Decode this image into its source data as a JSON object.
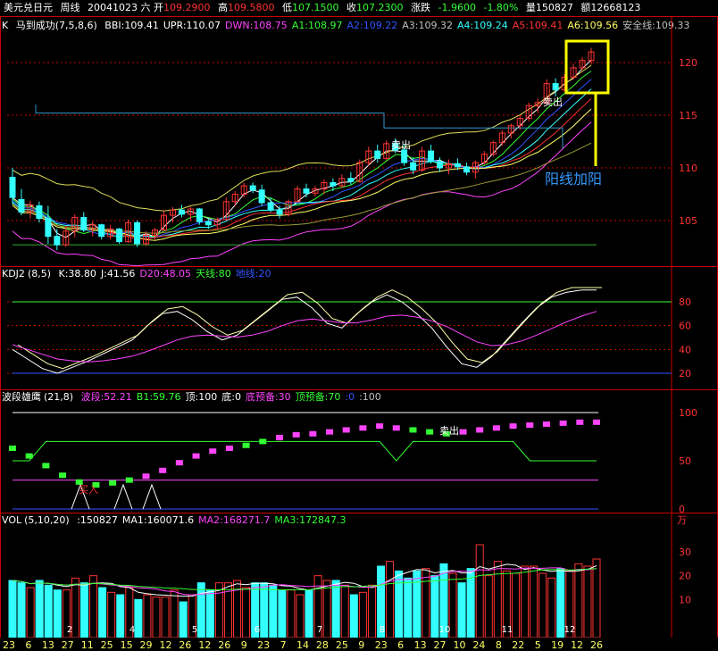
{
  "header": {
    "symbol": "美元兑日元",
    "period": "周线",
    "date": "20041023 六",
    "open_label": "开",
    "open": "109.2900",
    "high_label": "高",
    "high": "109.5800",
    "low_label": "低",
    "low": "107.1500",
    "close_label": "收",
    "close": "107.2300",
    "chg_label": "涨跌",
    "chg": "-1.9600",
    "chg_pct": "-1.80%",
    "vol_label": "量",
    "vol": "150827",
    "amt_label": "额",
    "amt": "12668123"
  },
  "k_panel": {
    "label": "K",
    "name": "马到成功",
    "params": "(7,5,8,6)",
    "items": [
      {
        "text": "BBI:109.41",
        "color": "#ffffff"
      },
      {
        "text": "UPR:110.07",
        "color": "#ffffff"
      },
      {
        "text": "DWN:108.75",
        "color": "#ff44ff"
      },
      {
        "text": "A1:108.97",
        "color": "#33ff33"
      },
      {
        "text": "A2:109.22",
        "color": "#3355ff"
      },
      {
        "text": "A3:109.32",
        "color": "#c0c0c0"
      },
      {
        "text": "A4:109.24",
        "color": "#33ffff"
      },
      {
        "text": "A5:109.41",
        "color": "#ff3333"
      },
      {
        "text": "A6:109.56",
        "color": "#ffff66"
      },
      {
        "text": "安全线:109.33",
        "color": "#c0c0c0"
      }
    ],
    "y_ticks": [
      "120",
      "115",
      "110",
      "105"
    ],
    "annotation": "阳线加阳",
    "sell_label_1": "卖出",
    "sell_label_2": "卖出"
  },
  "kdj_panel": {
    "name": "KDJ2",
    "params": "(8,5)",
    "items": [
      {
        "text": "K:38.80",
        "color": "#ffffff"
      },
      {
        "text": "J:41.56",
        "color": "#ffffff"
      },
      {
        "text": "D20:48.05",
        "color": "#ff44ff"
      },
      {
        "text": "天线:80",
        "color": "#33ff33"
      },
      {
        "text": "地线:20",
        "color": "#3355ff"
      }
    ],
    "y_ticks": [
      "80",
      "60",
      "40",
      "20"
    ]
  },
  "wave_panel": {
    "name": "波段雄鹰",
    "params": "(21,8)",
    "items": [
      {
        "text": "波段:52.21",
        "color": "#ff44ff"
      },
      {
        "text": "B1:59.76",
        "color": "#33ff33"
      },
      {
        "text": "顶:100",
        "color": "#ffffff"
      },
      {
        "text": "底:0",
        "color": "#ffffff"
      },
      {
        "text": "底预备:30",
        "color": "#ff44ff"
      },
      {
        "text": "顶预备:70",
        "color": "#33ff33"
      },
      {
        "text": ":0",
        "color": "#3355ff"
      },
      {
        "text": ":100",
        "color": "#c0c0c0"
      }
    ],
    "y_ticks": [
      "100",
      "50",
      "0"
    ],
    "buy_label": "买入",
    "sell_label": "卖出"
  },
  "vol_panel": {
    "name": "VOL",
    "params": "(5,10,20)",
    "items": [
      {
        "text": ":150827",
        "color": "#ffffff"
      },
      {
        "text": "MA1:160071.6",
        "color": "#ffffff"
      },
      {
        "text": "MA2:168271.7",
        "color": "#ff44ff"
      },
      {
        "text": "MA3:172847.3",
        "color": "#33ff33"
      }
    ],
    "unit": "万",
    "y_ticks": [
      "30",
      "20",
      "10"
    ]
  },
  "x_axis": {
    "labels": [
      "23",
      "6",
      "13",
      "27",
      "11",
      "25",
      "15",
      "29",
      "12",
      "26",
      "12",
      "26",
      "9",
      "23",
      "7",
      "14",
      "28",
      "25",
      "9",
      "23",
      "6",
      "13",
      "27",
      "10",
      "24",
      "8",
      "22",
      "5",
      "19",
      "12",
      "26"
    ],
    "month_markers": [
      "2",
      "4",
      "5",
      "6",
      "7",
      "8",
      "10",
      "11",
      "12"
    ]
  },
  "colors": {
    "up": "#ff3333",
    "down": "#33ffff",
    "text": "#c0c0c0",
    "grid": "#cc0000",
    "highlight": "#ffff00"
  },
  "chart_data": {
    "type": "candlestick",
    "title": "美元兑日元 周线",
    "y_range": [
      101,
      123
    ],
    "candles": [
      {
        "o": 109.1,
        "h": 110.0,
        "l": 106.5,
        "c": 107.2
      },
      {
        "o": 107.0,
        "h": 108.0,
        "l": 105.5,
        "c": 105.8
      },
      {
        "o": 105.8,
        "h": 106.9,
        "l": 105.2,
        "c": 106.5
      },
      {
        "o": 106.4,
        "h": 106.8,
        "l": 104.8,
        "c": 105.2
      },
      {
        "o": 105.2,
        "h": 106.4,
        "l": 102.8,
        "c": 103.5
      },
      {
        "o": 103.5,
        "h": 104.2,
        "l": 102.2,
        "c": 102.7
      },
      {
        "o": 102.7,
        "h": 104.5,
        "l": 102.5,
        "c": 104.0
      },
      {
        "o": 104.0,
        "h": 105.6,
        "l": 103.4,
        "c": 105.3
      },
      {
        "o": 105.3,
        "h": 105.8,
        "l": 103.9,
        "c": 104.1
      },
      {
        "o": 104.1,
        "h": 104.9,
        "l": 103.5,
        "c": 104.6
      },
      {
        "o": 104.6,
        "h": 104.7,
        "l": 103.2,
        "c": 103.5
      },
      {
        "o": 103.5,
        "h": 104.6,
        "l": 103.2,
        "c": 104.2
      },
      {
        "o": 104.2,
        "h": 104.3,
        "l": 102.8,
        "c": 103.0
      },
      {
        "o": 103.0,
        "h": 105.1,
        "l": 102.9,
        "c": 104.8
      },
      {
        "o": 104.8,
        "h": 105.0,
        "l": 102.5,
        "c": 102.8
      },
      {
        "o": 102.8,
        "h": 104.0,
        "l": 102.6,
        "c": 103.6
      },
      {
        "o": 103.6,
        "h": 104.3,
        "l": 103.2,
        "c": 104.1
      },
      {
        "o": 104.1,
        "h": 106.0,
        "l": 104.0,
        "c": 105.5
      },
      {
        "o": 105.5,
        "h": 106.3,
        "l": 104.8,
        "c": 106.0
      },
      {
        "o": 106.0,
        "h": 106.5,
        "l": 105.3,
        "c": 105.6
      },
      {
        "o": 105.6,
        "h": 106.3,
        "l": 105.0,
        "c": 106.1
      },
      {
        "o": 106.1,
        "h": 106.2,
        "l": 104.6,
        "c": 104.9
      },
      {
        "o": 104.9,
        "h": 105.2,
        "l": 104.2,
        "c": 104.6
      },
      {
        "o": 104.6,
        "h": 105.3,
        "l": 104.3,
        "c": 105.1
      },
      {
        "o": 105.1,
        "h": 107.2,
        "l": 105.0,
        "c": 106.8
      },
      {
        "o": 106.8,
        "h": 107.8,
        "l": 106.4,
        "c": 107.5
      },
      {
        "o": 107.5,
        "h": 108.6,
        "l": 107.2,
        "c": 108.3
      },
      {
        "o": 108.3,
        "h": 108.6,
        "l": 107.6,
        "c": 107.9
      },
      {
        "o": 107.9,
        "h": 108.4,
        "l": 106.4,
        "c": 106.7
      },
      {
        "o": 106.7,
        "h": 107.2,
        "l": 105.8,
        "c": 106.0
      },
      {
        "o": 106.0,
        "h": 106.4,
        "l": 105.2,
        "c": 105.6
      },
      {
        "o": 105.6,
        "h": 107.0,
        "l": 105.4,
        "c": 106.8
      },
      {
        "o": 106.8,
        "h": 108.3,
        "l": 106.7,
        "c": 108.0
      },
      {
        "o": 108.0,
        "h": 108.5,
        "l": 107.2,
        "c": 107.6
      },
      {
        "o": 107.6,
        "h": 108.3,
        "l": 107.3,
        "c": 108.0
      },
      {
        "o": 108.0,
        "h": 108.9,
        "l": 107.5,
        "c": 108.6
      },
      {
        "o": 108.6,
        "h": 109.0,
        "l": 107.8,
        "c": 108.3
      },
      {
        "o": 108.3,
        "h": 109.4,
        "l": 108.1,
        "c": 109.0
      },
      {
        "o": 109.0,
        "h": 109.6,
        "l": 108.4,
        "c": 108.7
      },
      {
        "o": 108.7,
        "h": 110.8,
        "l": 108.6,
        "c": 110.5
      },
      {
        "o": 110.5,
        "h": 112.0,
        "l": 110.2,
        "c": 111.6
      },
      {
        "o": 111.6,
        "h": 112.2,
        "l": 110.5,
        "c": 110.9
      },
      {
        "o": 110.9,
        "h": 112.6,
        "l": 110.7,
        "c": 112.3
      },
      {
        "o": 112.3,
        "h": 112.8,
        "l": 111.4,
        "c": 111.7
      },
      {
        "o": 111.7,
        "h": 112.3,
        "l": 110.2,
        "c": 110.5
      },
      {
        "o": 110.5,
        "h": 111.0,
        "l": 109.4,
        "c": 109.8
      },
      {
        "o": 109.8,
        "h": 112.0,
        "l": 109.6,
        "c": 111.6
      },
      {
        "o": 111.6,
        "h": 112.2,
        "l": 110.4,
        "c": 110.6
      },
      {
        "o": 110.6,
        "h": 111.0,
        "l": 109.6,
        "c": 110.0
      },
      {
        "o": 110.0,
        "h": 110.8,
        "l": 109.4,
        "c": 110.4
      },
      {
        "o": 110.4,
        "h": 110.9,
        "l": 109.8,
        "c": 110.1
      },
      {
        "o": 110.1,
        "h": 110.5,
        "l": 109.3,
        "c": 109.6
      },
      {
        "o": 109.6,
        "h": 110.7,
        "l": 109.0,
        "c": 110.5
      },
      {
        "o": 110.5,
        "h": 111.6,
        "l": 110.3,
        "c": 111.3
      },
      {
        "o": 111.3,
        "h": 112.6,
        "l": 111.1,
        "c": 112.4
      },
      {
        "o": 112.4,
        "h": 113.6,
        "l": 112.1,
        "c": 113.3
      },
      {
        "o": 113.3,
        "h": 114.2,
        "l": 112.8,
        "c": 114.0
      },
      {
        "o": 114.0,
        "h": 115.0,
        "l": 113.6,
        "c": 114.7
      },
      {
        "o": 114.7,
        "h": 116.2,
        "l": 114.4,
        "c": 115.9
      },
      {
        "o": 115.9,
        "h": 116.6,
        "l": 115.2,
        "c": 116.2
      },
      {
        "o": 116.2,
        "h": 118.4,
        "l": 116.0,
        "c": 118.0
      },
      {
        "o": 118.0,
        "h": 118.5,
        "l": 116.8,
        "c": 117.4
      },
      {
        "o": 117.4,
        "h": 118.9,
        "l": 117.2,
        "c": 118.6
      },
      {
        "o": 118.6,
        "h": 119.9,
        "l": 118.4,
        "c": 119.5
      },
      {
        "o": 119.5,
        "h": 120.5,
        "l": 119.3,
        "c": 120.2
      },
      {
        "o": 120.2,
        "h": 121.4,
        "l": 119.8,
        "c": 121.0
      }
    ],
    "volume": [
      18,
      17,
      15,
      18,
      16,
      14,
      14,
      19,
      17,
      20,
      15,
      13,
      12,
      15,
      10,
      12,
      11,
      11,
      14,
      9,
      12,
      17,
      14,
      17,
      17,
      18,
      15,
      17,
      17,
      16,
      14,
      14,
      12,
      14,
      20,
      18,
      18,
      16,
      12,
      13,
      16,
      24,
      26,
      22,
      19,
      22,
      23,
      20,
      25,
      21,
      17,
      23,
      33,
      20,
      26,
      22,
      21,
      24,
      24,
      21,
      19,
      23,
      22,
      25,
      24,
      27
    ],
    "kdj_k": [
      40,
      32,
      24,
      20,
      25,
      30,
      36,
      42,
      48,
      60,
      70,
      72,
      65,
      55,
      48,
      52,
      62,
      72,
      82,
      84,
      75,
      62,
      58,
      70,
      80,
      86,
      80,
      70,
      58,
      42,
      28,
      25,
      34,
      48,
      62,
      75,
      84,
      88,
      90,
      90
    ],
    "kdj_d": [
      45,
      40,
      35,
      30,
      28,
      27,
      28,
      30,
      33,
      38,
      44,
      50,
      54,
      55,
      54,
      53,
      55,
      59,
      65,
      70,
      72,
      70,
      68,
      68,
      71,
      75,
      76,
      74,
      70,
      64,
      56,
      48,
      44,
      45,
      49,
      55,
      62,
      69,
      75,
      80
    ],
    "wave": [
      63,
      55,
      45,
      35,
      28,
      25,
      27,
      30,
      34,
      40,
      48,
      55,
      60,
      63,
      66,
      70,
      74,
      77,
      78,
      80,
      82,
      84,
      86,
      84,
      82,
      80,
      78,
      80,
      82,
      84,
      86,
      87,
      88,
      89,
      90,
      90
    ],
    "wave_b1": [
      50,
      50,
      70,
      70,
      70,
      70,
      70,
      70,
      70,
      70,
      70,
      70,
      70,
      70,
      70,
      70,
      70,
      70,
      70,
      70,
      70,
      70,
      70,
      50,
      70,
      70,
      70,
      70,
      70,
      70,
      70,
      50,
      50,
      50,
      50,
      50
    ]
  }
}
